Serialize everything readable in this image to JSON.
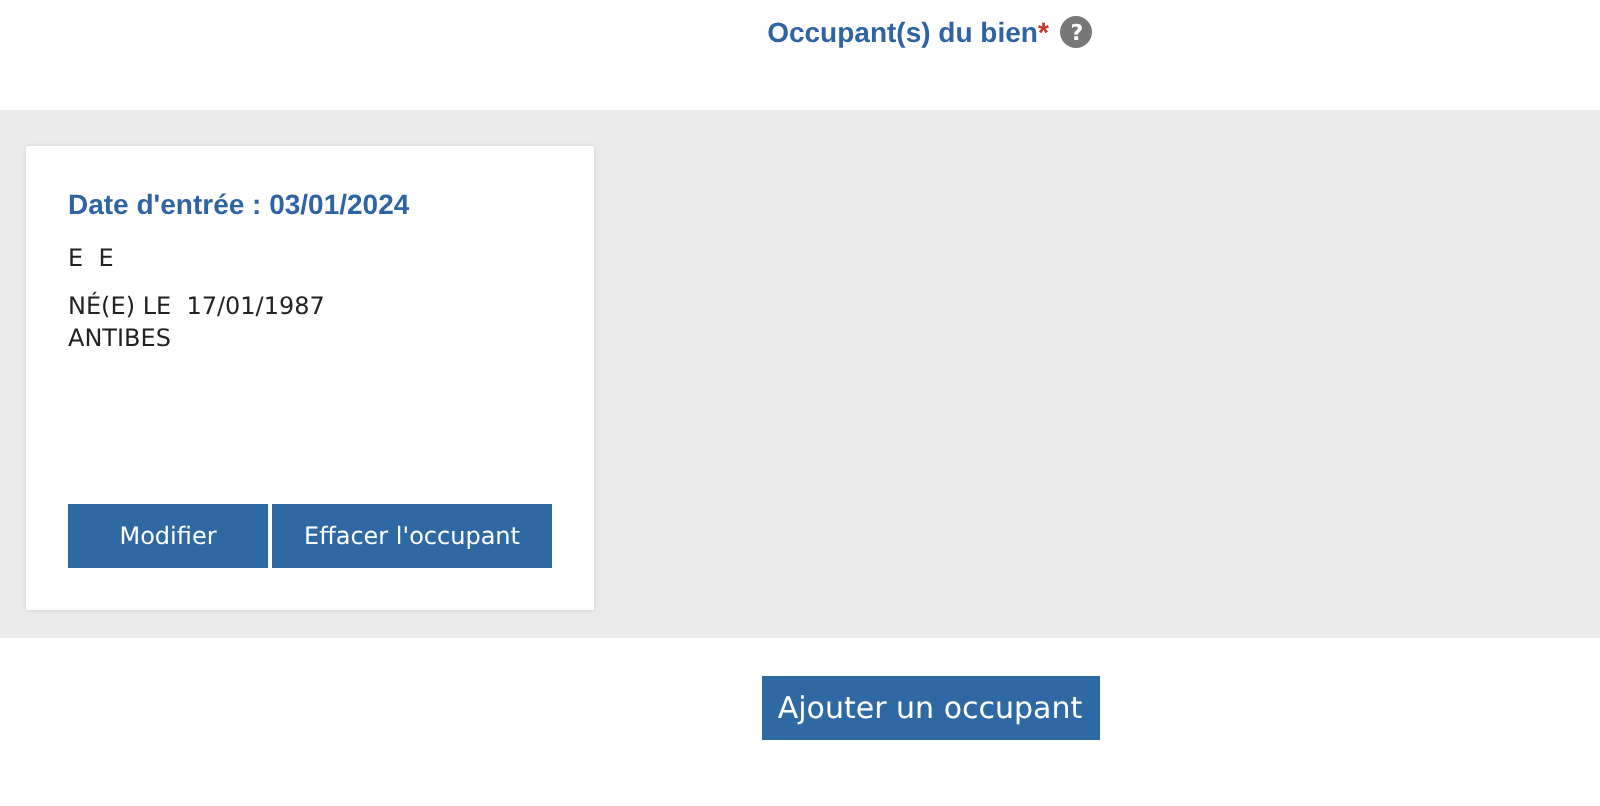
{
  "section": {
    "title": "Occupant(s) du bien",
    "required_mark": "*",
    "help": "?"
  },
  "occupants": [
    {
      "entry_date": "Date d'entrée : 03/01/2024",
      "name": "E  E",
      "birth": "NÉ(E) LE  17/01/1987",
      "birthplace": "ANTIBES",
      "actions": [
        "Modifier",
        "Effacer l'occupant"
      ]
    }
  ],
  "add_button": "Ajouter un occupant"
}
